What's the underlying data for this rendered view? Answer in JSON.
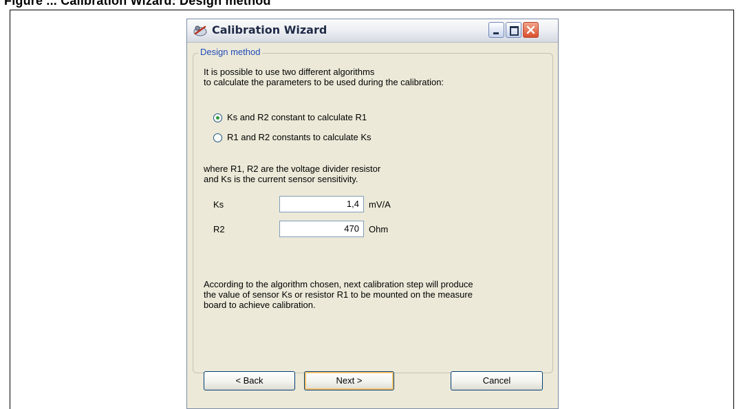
{
  "document": {
    "caption": "Figure ... Calibration Wizard: Design method"
  },
  "window": {
    "title": "Calibration Wizard",
    "controls": [
      "minimize-icon",
      "maximize-icon",
      "close-icon"
    ]
  },
  "group": {
    "legend": "Design method"
  },
  "intro": {
    "line1": "It is possible to use two different algorithms",
    "line2": "to calculate the parameters to be used during the calibration:"
  },
  "options": [
    {
      "label": "Ks and R2 constant to calculate R1",
      "checked": true
    },
    {
      "label": "R1 and R2 constants to calculate Ks",
      "checked": false
    }
  ],
  "where": {
    "line1": "where R1, R2 are the voltage divider resistor",
    "line2": "and Ks is the current sensor sensitivity."
  },
  "params": [
    {
      "label": "Ks",
      "value": "1,4",
      "unit": "mV/A"
    },
    {
      "label": "R2",
      "value": "470",
      "unit": "Ohm"
    }
  ],
  "note": {
    "line1": "According to the algorithm chosen, next calibration step will produce",
    "line2": "the value of sensor Ks or resistor R1 to be mounted on the measure",
    "line3": "board to achieve calibration."
  },
  "buttons": {
    "back": "< Back",
    "next": "Next >",
    "cancel": "Cancel"
  }
}
